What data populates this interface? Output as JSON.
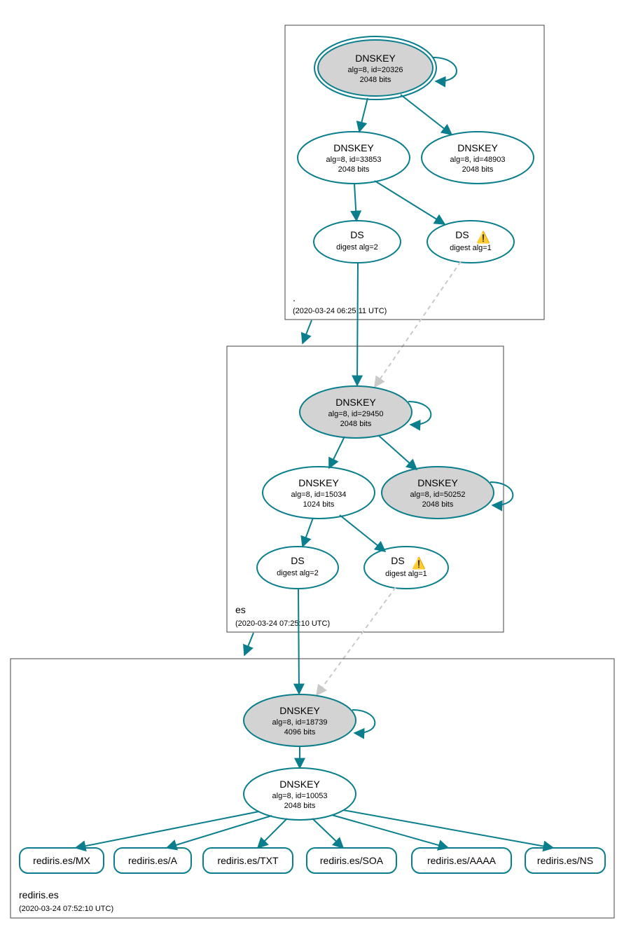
{
  "colors": {
    "accent": "#0a7e8c",
    "node_fill_grey": "#d3d3d3"
  },
  "zones": {
    "root": {
      "label": ".",
      "timestamp": "(2020-03-24 06:25:11 UTC)"
    },
    "es": {
      "label": "es",
      "timestamp": "(2020-03-24 07:25:10 UTC)"
    },
    "leaf": {
      "label": "rediris.es",
      "timestamp": "(2020-03-24 07:52:10 UTC)"
    }
  },
  "nodes": {
    "root_ksk": {
      "title": "DNSKEY",
      "line1": "alg=8, id=20326",
      "line2": "2048 bits"
    },
    "root_zsk1": {
      "title": "DNSKEY",
      "line1": "alg=8, id=33853",
      "line2": "2048 bits"
    },
    "root_zsk2": {
      "title": "DNSKEY",
      "line1": "alg=8, id=48903",
      "line2": "2048 bits"
    },
    "root_ds2": {
      "title": "DS",
      "line1": "digest alg=2"
    },
    "root_ds1": {
      "title": "DS",
      "line1": "digest alg=1"
    },
    "es_ksk": {
      "title": "DNSKEY",
      "line1": "alg=8, id=29450",
      "line2": "2048 bits"
    },
    "es_zsk": {
      "title": "DNSKEY",
      "line1": "alg=8, id=15034",
      "line2": "1024 bits"
    },
    "es_key2": {
      "title": "DNSKEY",
      "line1": "alg=8, id=50252",
      "line2": "2048 bits"
    },
    "es_ds2": {
      "title": "DS",
      "line1": "digest alg=2"
    },
    "es_ds1": {
      "title": "DS",
      "line1": "digest alg=1"
    },
    "r_ksk": {
      "title": "DNSKEY",
      "line1": "alg=8, id=18739",
      "line2": "4096 bits"
    },
    "r_zsk": {
      "title": "DNSKEY",
      "line1": "alg=8, id=10053",
      "line2": "2048 bits"
    }
  },
  "leaves": {
    "mx": "rediris.es/MX",
    "a": "rediris.es/A",
    "txt": "rediris.es/TXT",
    "soa": "rediris.es/SOA",
    "aaaa": "rediris.es/AAAA",
    "ns": "rediris.es/NS"
  },
  "warnings": {
    "ds1": "⚠️"
  }
}
